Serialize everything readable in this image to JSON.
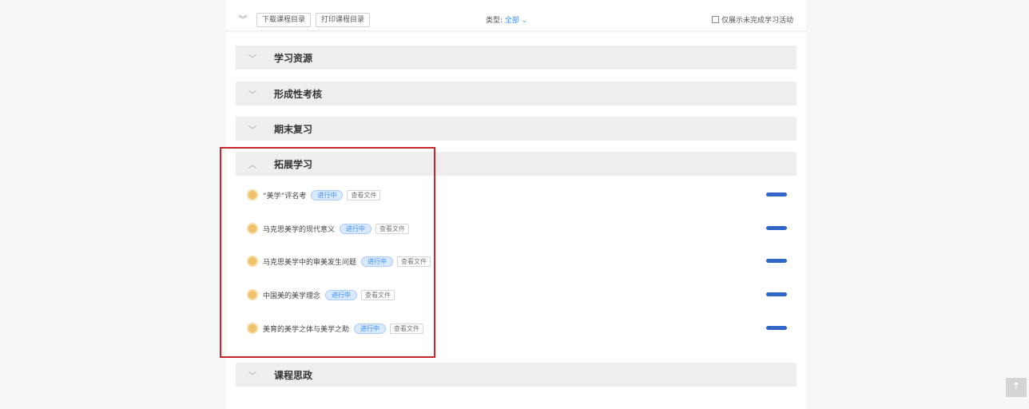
{
  "toolbar": {
    "collapse_icon": "double-chevron-icon",
    "download_label": "下载课程目录",
    "print_label": "打印课程目录",
    "type_label": "类型:",
    "type_value": "全部",
    "only_unfinished_label": "仅展示未完成学习活动"
  },
  "sections": [
    {
      "title": "学习资源"
    },
    {
      "title": "形成性考核"
    },
    {
      "title": "期末复习"
    },
    {
      "title": "拓展学习"
    },
    {
      "title": "课程思政"
    }
  ],
  "items": [
    {
      "name": "“美学”评名考",
      "status": "进行中",
      "file": "查看文件"
    },
    {
      "name": "马克思美学的现代意义",
      "status": "进行中",
      "file": "查看文件"
    },
    {
      "name": "马克思美学中的审美发生问题",
      "status": "进行中",
      "file": "查看文件"
    },
    {
      "name": "中国美的美学理念",
      "status": "进行中",
      "file": "查看文件"
    },
    {
      "name": "美育的美学之体与美学之助",
      "status": "进行中",
      "file": "查看文件"
    }
  ],
  "colors": {
    "accent": "#3b8df0",
    "progress_bar": "#2f66c8",
    "highlight_border": "#c8262a"
  }
}
